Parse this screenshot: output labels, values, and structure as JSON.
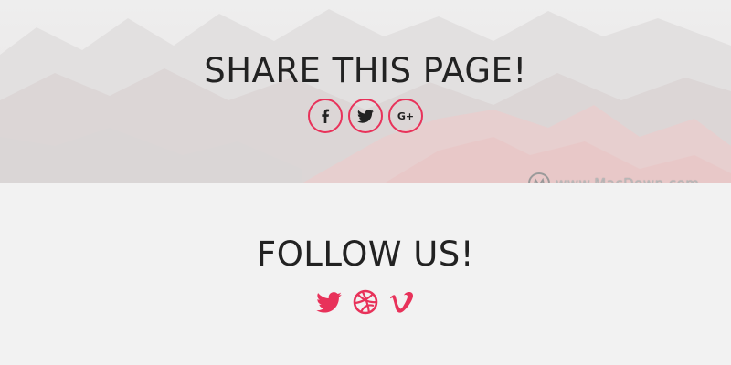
{
  "share": {
    "title": "SHARE THIS PAGE!",
    "buttons": [
      {
        "icon": "facebook-icon"
      },
      {
        "icon": "twitter-icon"
      },
      {
        "icon": "google-plus-icon",
        "label": "G+"
      }
    ]
  },
  "follow": {
    "title": "FOLLOW US!",
    "links": [
      {
        "icon": "twitter-icon"
      },
      {
        "icon": "dribbble-icon"
      },
      {
        "icon": "vimeo-icon"
      }
    ]
  },
  "watermark": {
    "text": "www.MacDown.com"
  },
  "colors": {
    "accent": "#e8325a",
    "text": "#222222",
    "background": "#f2f2f2"
  }
}
